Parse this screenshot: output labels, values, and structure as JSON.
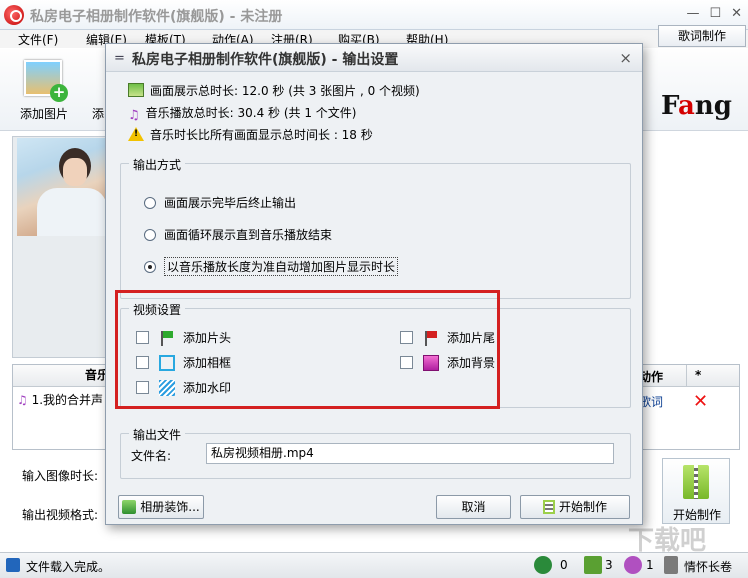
{
  "main_window": {
    "title": "私房电子相册制作软件(旗舰版) - 未注册",
    "controls": {
      "minimize": "—",
      "maximize": "☐",
      "close": "✕"
    },
    "menu": [
      "文件(F)",
      "编辑(E)",
      "模板(T)",
      "动作(A)",
      "注册(R)",
      "购买(B)",
      "帮助(H)"
    ],
    "lyrics_button": "歌词制作",
    "toolbar": {
      "add_picture": "添加图片",
      "add_other_partial": "添"
    },
    "brand": {
      "prefix": "F",
      "red": "a",
      "suffix": "ng"
    },
    "music_list": {
      "header": "音乐",
      "row": "1.我的合并声",
      "right_header_a": "动作",
      "right_header_b": "*",
      "lyrics_link": "歌词"
    },
    "input_image_duration_label": "输入图像时长:",
    "output_video_format_label": "输出视频格式:",
    "start_button": "开始制作",
    "status": {
      "text": "文件载入完成。",
      "count_video": "0",
      "count_image": "3",
      "count_music": "1",
      "song": "情怀长卷"
    },
    "watermark": "下载吧"
  },
  "dialog": {
    "title": "私房电子相册制作软件(旗舰版) - 输出设置",
    "close": "×",
    "info": {
      "picture_total": "画面展示总时长: 12.0 秒 (共 3 张图片 , 0 个视频)",
      "music_total": "音乐播放总时长: 30.4 秒 (共 1 个文件)",
      "warning": "音乐时长比所有画面显示总时间长 : 18 秒"
    },
    "output_mode": {
      "label": "输出方式",
      "options": [
        "画面展示完毕后终止输出",
        "画面循环展示直到音乐播放结束",
        "以音乐播放长度为准自动增加图片显示时长"
      ],
      "selected_index": 2
    },
    "video_settings": {
      "label": "视频设置",
      "add_intro": "添加片头",
      "add_outro": "添加片尾",
      "add_frame": "添加相框",
      "add_background": "添加背景",
      "add_watermark": "添加水印"
    },
    "output_file": {
      "label": "输出文件",
      "file_name_label": "文件名:",
      "file_name_value": "私房视频相册.mp4"
    },
    "buttons": {
      "decorate": "相册装饰...",
      "cancel": "取消",
      "start": "开始制作"
    }
  }
}
